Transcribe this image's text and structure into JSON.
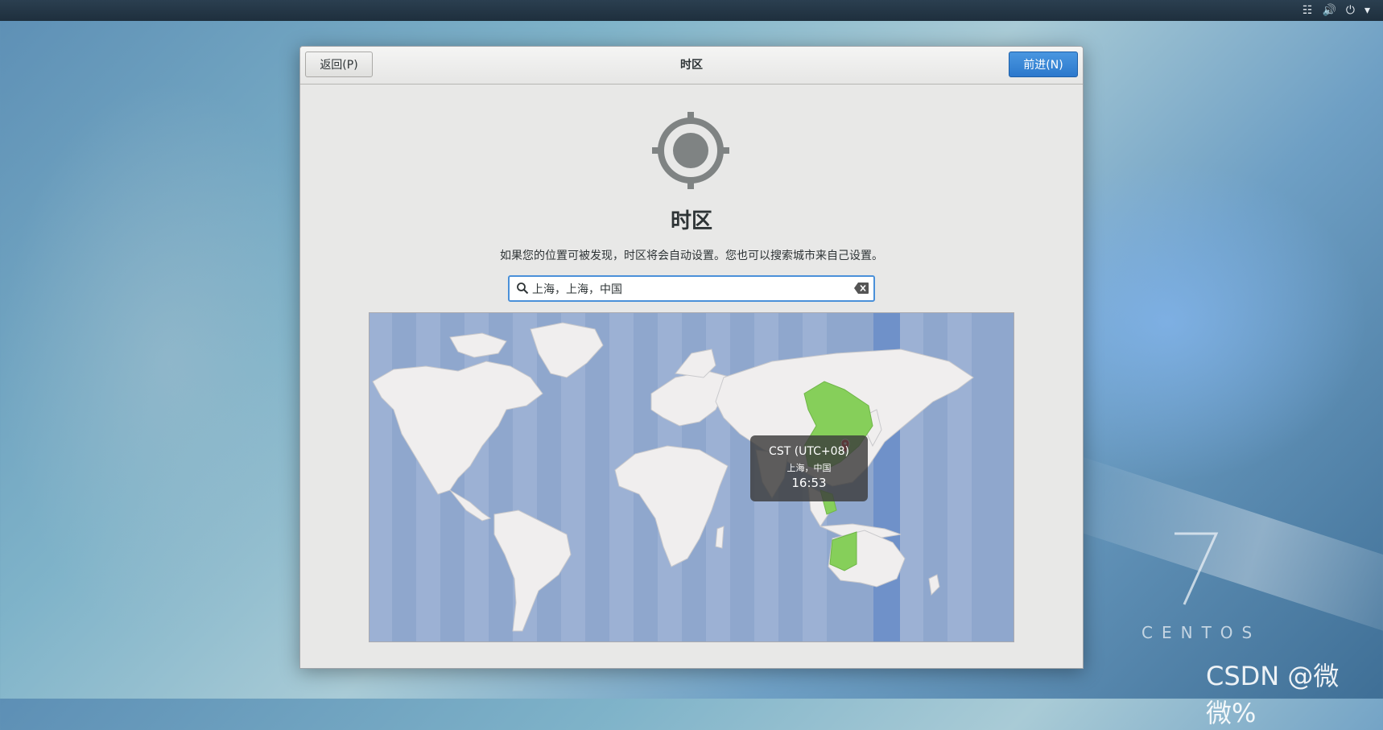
{
  "topbar": {
    "icons": [
      "network-icon",
      "volume-icon",
      "power-icon",
      "chevron-down-icon"
    ]
  },
  "window": {
    "title": "时区",
    "back_label": "返回(P)",
    "next_label": "前进(N)",
    "page_title": "时区",
    "description": "如果您的位置可被发现，时区将会自动设置。您也可以搜索城市来自己设置。",
    "search": {
      "value": "上海，上海，中国",
      "icon": "search-icon",
      "clear_icon": "clear-icon"
    },
    "hero_icon": "location-target-icon"
  },
  "map": {
    "selected_zone": "CST (UTC+08)",
    "selected_city": "上海，中国",
    "current_time": "16:53",
    "colors": {
      "ocean": "#8fa7cd",
      "land": "#f0eeee",
      "selected_zone": "#86cf5a",
      "highlight_band": "#6f91c9",
      "marker": "#e0262a"
    }
  },
  "brand": {
    "version": "7",
    "name": "CENTOS"
  },
  "watermark": "CSDN @微微%"
}
